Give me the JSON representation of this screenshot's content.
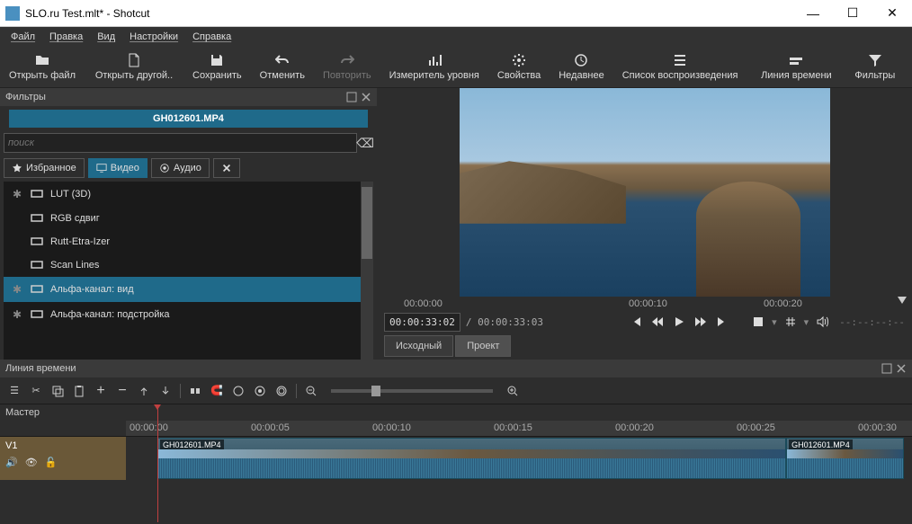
{
  "window": {
    "title": "SLO.ru Test.mlt* - Shotcut"
  },
  "menu": [
    "Файл",
    "Правка",
    "Вид",
    "Настройки",
    "Справка"
  ],
  "toolbar": [
    {
      "id": "open-file",
      "label": "Открыть файл",
      "icon": "folder"
    },
    {
      "id": "open-other",
      "label": "Открыть другой..",
      "icon": "file-plus"
    },
    {
      "id": "save",
      "label": "Сохранить",
      "icon": "save"
    },
    {
      "id": "undo",
      "label": "Отменить",
      "icon": "undo"
    },
    {
      "id": "redo",
      "label": "Повторить",
      "icon": "redo",
      "disabled": true
    },
    {
      "id": "meter",
      "label": "Измеритель уровня",
      "icon": "meter"
    },
    {
      "id": "properties",
      "label": "Свойства",
      "icon": "gear"
    },
    {
      "id": "recent",
      "label": "Недавнее",
      "icon": "clock"
    },
    {
      "id": "playlist",
      "label": "Список воспроизведения",
      "icon": "list"
    },
    {
      "id": "timeline",
      "label": "Линия времени",
      "icon": "timeline"
    },
    {
      "id": "filters",
      "label": "Фильтры",
      "icon": "filter"
    }
  ],
  "filters_panel": {
    "title": "Фильтры",
    "filename": "GH012601.MP4",
    "search_placeholder": "поиск",
    "tabs": [
      {
        "id": "favorites",
        "label": "Избранное",
        "icon": "star"
      },
      {
        "id": "video",
        "label": "Видео",
        "icon": "monitor",
        "active": true
      },
      {
        "id": "audio",
        "label": "Аудио",
        "icon": "target"
      },
      {
        "id": "close",
        "label": "",
        "icon": "close"
      }
    ],
    "items": [
      {
        "label": "LUT (3D)",
        "starred": true
      },
      {
        "label": "RGB сдвиг"
      },
      {
        "label": "Rutt-Etra-Izer"
      },
      {
        "label": "Scan Lines"
      },
      {
        "label": "Альфа-канал: вид",
        "selected": true,
        "starred": true
      },
      {
        "label": "Альфа-канал: подстройка",
        "starred": true
      }
    ]
  },
  "preview": {
    "ruler": [
      "00:00:00",
      "00:00:10",
      "00:00:20"
    ],
    "current": "00:00:33:02",
    "total": "/ 00:00:33:03",
    "readout": "--:--:--:--",
    "source_btn": "Исходный",
    "project_btn": "Проект"
  },
  "timeline": {
    "title": "Линия времени",
    "master": "Мастер",
    "track": "V1",
    "ruler": [
      "00:00:00",
      "00:00:05",
      "00:00:10",
      "00:00:15",
      "00:00:20",
      "00:00:25",
      "00:00:30"
    ],
    "clips": [
      {
        "label": "GH012601.MP4",
        "start_pct": 4,
        "width_pct": 80
      },
      {
        "label": "GH012601.MP4",
        "start_pct": 84,
        "width_pct": 15
      }
    ],
    "playhead_pct": 4
  }
}
